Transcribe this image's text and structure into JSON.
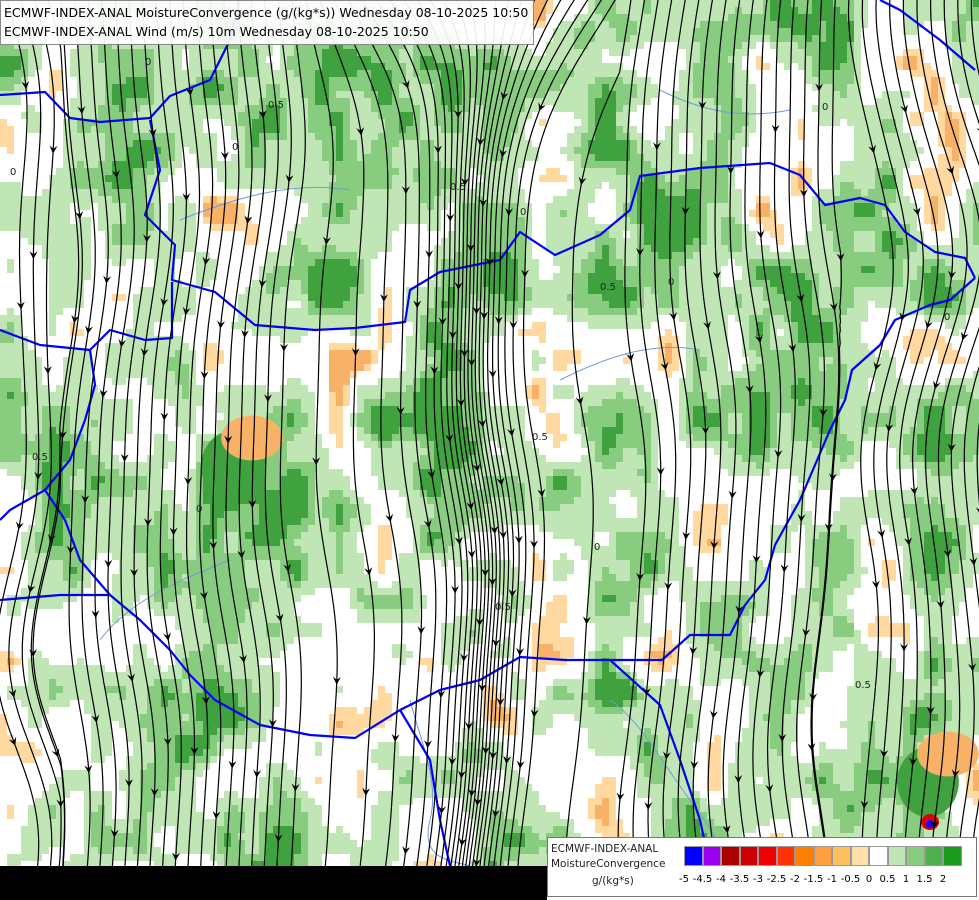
{
  "header": {
    "line1": "ECMWF-INDEX-ANAL MoistureConvergence (g/(kg*s)) Wednesday 08-10-2025 10:50",
    "line2": "ECMWF-INDEX-ANAL Wind (m/s) 10m Wednesday 08-10-2025 10:50"
  },
  "legend": {
    "line1": "ECMWF-INDEX-ANAL",
    "line2": "MoistureConvergence",
    "unit": "g/(kg*s)",
    "ticks": [
      "-5",
      "-4.5",
      "-4",
      "-3.5",
      "-3",
      "-2.5",
      "-2",
      "-1.5",
      "-1",
      "-0.5",
      "0",
      "0.5",
      "1",
      "1.5",
      "2"
    ],
    "colors": [
      "#0000ff",
      "#9900ee",
      "#aa0000",
      "#cc0000",
      "#ee0000",
      "#ff3300",
      "#ff7f00",
      "#ffa040",
      "#ffc060",
      "#ffe0a8",
      "#ffffff",
      "#bfe6b4",
      "#88cc80",
      "#4cb04c",
      "#1a9a1a"
    ]
  },
  "map": {
    "colors": {
      "background": "#ffffff",
      "convergence_light": "#bfe6b4",
      "convergence_medium": "#88cc80",
      "convergence_strong": "#3fa23f",
      "divergence_light": "#ffd9a0",
      "divergence_medium": "#f7b268",
      "border": "#0000ff",
      "river": "#7799dd",
      "streamline": "#000000"
    },
    "contour_labels": [
      "0",
      "0.5",
      "0",
      "0.5",
      "0",
      "0.5",
      "0",
      "0.5",
      "0",
      "0",
      "0.5",
      "0",
      "0.5",
      "0",
      "0.5",
      "0"
    ]
  }
}
